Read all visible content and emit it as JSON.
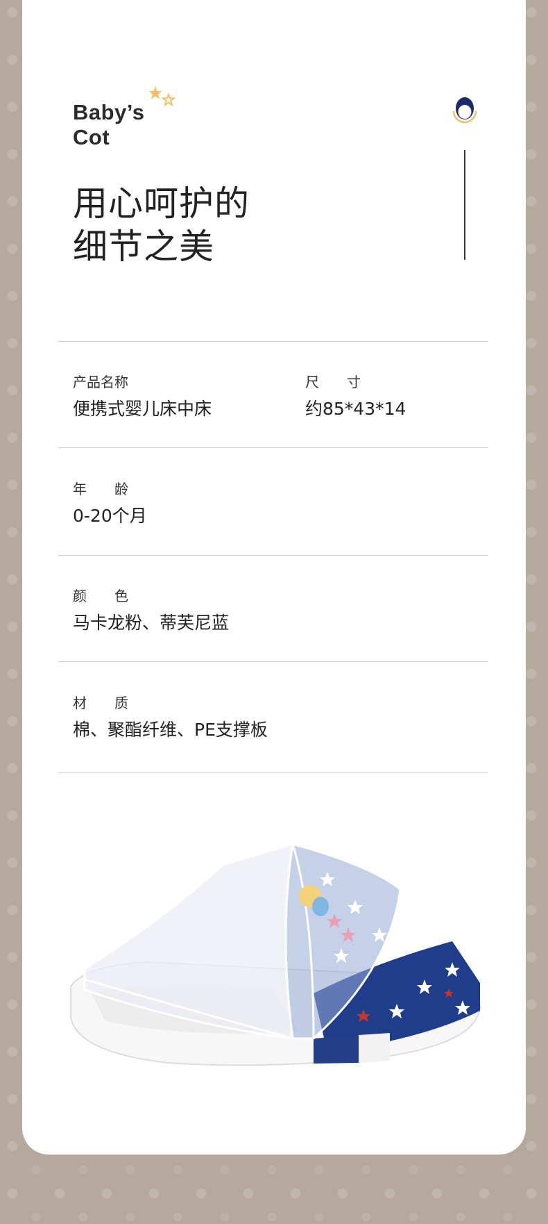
{
  "brand": {
    "line1": "Baby’s",
    "line2": "Cot"
  },
  "headline": {
    "line1": "用心呵护的",
    "line2": "细节之美"
  },
  "specs": {
    "name": {
      "label": "产品名称",
      "value": "便携式婴儿床中床"
    },
    "size": {
      "label": "尺　　寸",
      "value": "约85*43*14"
    },
    "age": {
      "label": "年　　龄",
      "value": "0-20个月"
    },
    "color": {
      "label": "颜　　色",
      "value": "马卡龙粉、蒂芙尼蓝"
    },
    "material": {
      "label": "材　　质",
      "value": "棉、聚酯纤维、PE支撑板"
    }
  },
  "colors": {
    "background": "#b5a89c",
    "card": "#ffffff",
    "star_accent": "#f3c06a",
    "mascot_navy": "#1c2a6b",
    "cot_navy": "#1f3d8a"
  },
  "icons": {
    "stars": "stars-icon",
    "mascot": "mascot-logo-icon"
  }
}
